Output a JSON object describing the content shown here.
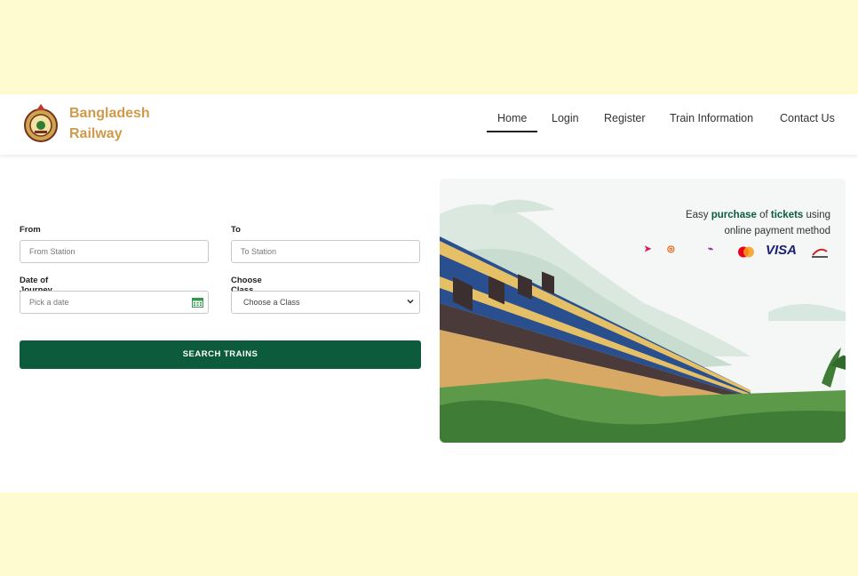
{
  "brand": {
    "line1": "Bangladesh",
    "line2": "Railway",
    "color": "#d19a4a"
  },
  "nav": {
    "items": [
      {
        "label": "Home",
        "active": true
      },
      {
        "label": "Login"
      },
      {
        "label": "Register"
      },
      {
        "label": "Train Information"
      },
      {
        "label": "Contact Us"
      }
    ]
  },
  "form": {
    "from": {
      "label": "From",
      "placeholder": "From Station"
    },
    "to": {
      "label": "To",
      "placeholder": "To Station"
    },
    "date": {
      "label": "Date of Journey",
      "placeholder": "Pick a date"
    },
    "class": {
      "label": "Choose Class",
      "selected": "Choose a Class"
    },
    "search_label": "SEARCH TRAINS"
  },
  "hero": {
    "promo": {
      "p1": "Easy ",
      "purchase": "purchase",
      "p2": " of ",
      "tickets": "tickets",
      "p3": " using",
      "line2": "online payment method"
    },
    "payment_logos": [
      "bkash-icon",
      "nagad-icon",
      "rocket-icon",
      "mastercard-icon",
      "VISA",
      "dbbl-nexus-icon"
    ]
  },
  "colors": {
    "accent": "#0b5b3c",
    "band": "#fffbd0"
  }
}
